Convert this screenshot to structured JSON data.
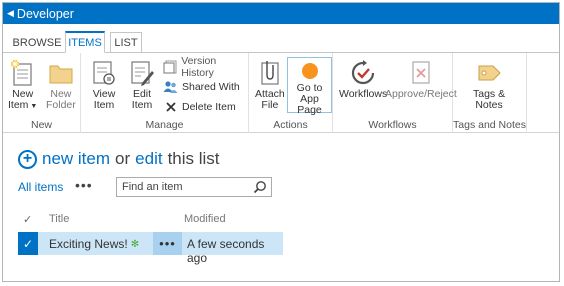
{
  "suitebar": {
    "back_label": "Developer"
  },
  "tabs": [
    {
      "label": "BROWSE"
    },
    {
      "label": "ITEMS"
    },
    {
      "label": "LIST"
    }
  ],
  "ribbon": {
    "new_group": {
      "label": "New",
      "new_item": {
        "line1": "New",
        "line2": "Item"
      },
      "new_folder": {
        "line1": "New",
        "line2": "Folder"
      }
    },
    "manage_group": {
      "label": "Manage",
      "view_item": {
        "line1": "View",
        "line2": "Item"
      },
      "edit_item": {
        "line1": "Edit",
        "line2": "Item"
      },
      "version_history": "Version History",
      "shared_with": "Shared With",
      "delete_item": "Delete Item"
    },
    "actions_group": {
      "label": "Actions",
      "attach_file": {
        "line1": "Attach",
        "line2": "File"
      },
      "go_to_app": {
        "line1": "Go to App",
        "line2": "Page"
      }
    },
    "workflows_group": {
      "label": "Workflows",
      "workflows": "Workflows",
      "approve_reject": "Approve/Reject"
    },
    "tags_group": {
      "label": "Tags and Notes",
      "tags_notes": {
        "line1": "Tags &",
        "line2": "Notes"
      }
    }
  },
  "heading": {
    "new_item": "new item",
    "or": "or",
    "edit": "edit",
    "this_list": "this list"
  },
  "views": {
    "current": "All items",
    "more": "•••"
  },
  "search": {
    "placeholder": "Find an item"
  },
  "list": {
    "columns": {
      "check": "✓",
      "title": "Title",
      "modified": "Modified"
    },
    "rows": [
      {
        "title": "Exciting News!",
        "new_marker": "✻",
        "ellipsis": "•••",
        "modified": "A few seconds ago"
      }
    ]
  },
  "colors": {
    "accent": "#0072c6",
    "row_selected": "#cde6f7",
    "app_dot": "#f7941d"
  }
}
